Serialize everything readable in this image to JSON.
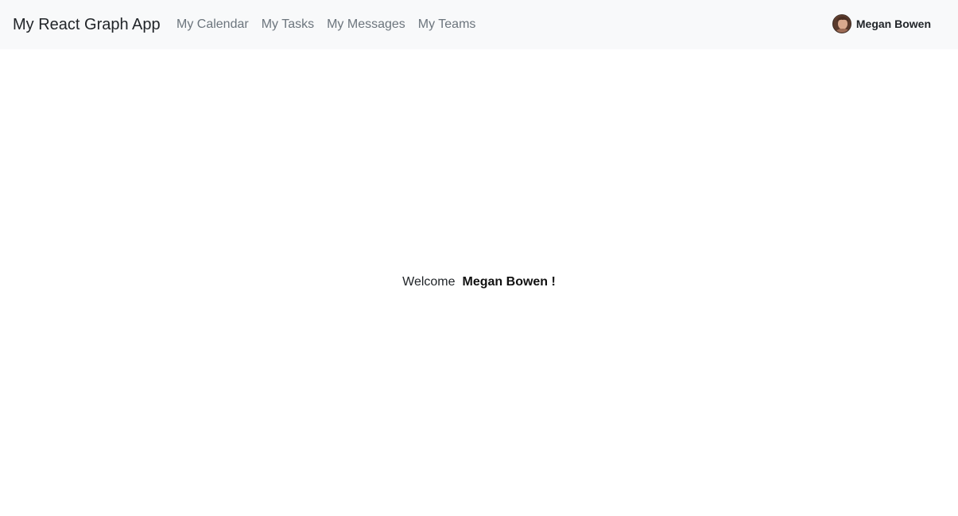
{
  "navbar": {
    "brand": "My React Graph App",
    "links": [
      {
        "label": "My Calendar"
      },
      {
        "label": "My Tasks"
      },
      {
        "label": "My Messages"
      },
      {
        "label": "My Teams"
      }
    ],
    "user": {
      "name": "Megan Bowen",
      "avatar_icon": "user-avatar"
    }
  },
  "main": {
    "welcome_prefix": "Welcome",
    "welcome_name": "Megan Bowen !"
  },
  "colors": {
    "navbar_bg": "#f8f9fa",
    "link_color": "#6c757d",
    "text_color": "#212529"
  }
}
